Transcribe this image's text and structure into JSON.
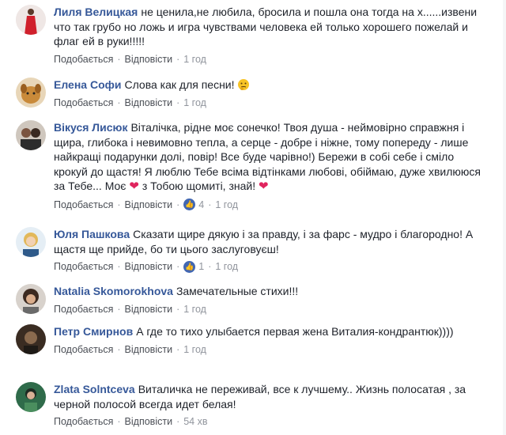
{
  "action_labels": {
    "like": "Подобається",
    "reply": "Відповісти"
  },
  "comments": [
    {
      "author": "Лиля Велицкая",
      "text": "не ценила,не любила, бросила и пошла она тогда на х......извени что так грубо но ложь и игра чувствами человека ей только хорошего пожелай и флаг ей в руки!!!!!",
      "time": "1 год",
      "avatar_icon": "woman-red-dress-avatar"
    },
    {
      "author": "Елена Софи",
      "text": "Слова как для песни!",
      "trailing_emoji": "thinking-face-emoji",
      "time": "1 год",
      "avatar_icon": "dog-avatar"
    },
    {
      "author": "Вікуся Лисюк",
      "text_part1": "Віталічка, рідне моє сонечко! Твоя душа - неймовірно справжня і щира, глибока і невимовно тепла, а серце - добре і ніжне, тому попереду - лише найкращі подарунки долі, повір! Все буде чарівно!) Бережи в собі себе і сміло крокуй до щастя! Я люблю Тебе всіма відтінками любові, обіймаю, дуже хвилююся за Тебе... Моє",
      "text_part2": "з Тобою щомиті, знай!",
      "heart_icon": "heart-emoji",
      "reactions": "4",
      "time": "1 год",
      "avatar_icon": "couple-avatar"
    },
    {
      "author": "Юля Пашкова",
      "text": "Сказати щире дякую і за правду, і за фарс - мудро і благородно! А щастя ще прийде, бо ти цього заслуговуєш!",
      "reactions": "1",
      "time": "1 год",
      "avatar_icon": "woman-blonde-avatar"
    },
    {
      "author": "Natalia Skomorokhova",
      "text": "Замечательные стихи!!!",
      "time": "1 год",
      "avatar_icon": "woman-curly-avatar"
    },
    {
      "author": "Петр Смирнов",
      "text": "А где то тихо улыбается первая жена Виталия-кондрантюк))))",
      "time": "1 год",
      "avatar_icon": "man-dark-avatar"
    },
    {
      "author": "Zlata Solntceva",
      "text": "Виталичка не переживай, все к лучшему.. Жизнь полосатая , за черной полосой всегда идет белая!",
      "time": "54 хв",
      "avatar_icon": "woman-green-avatar"
    }
  ]
}
